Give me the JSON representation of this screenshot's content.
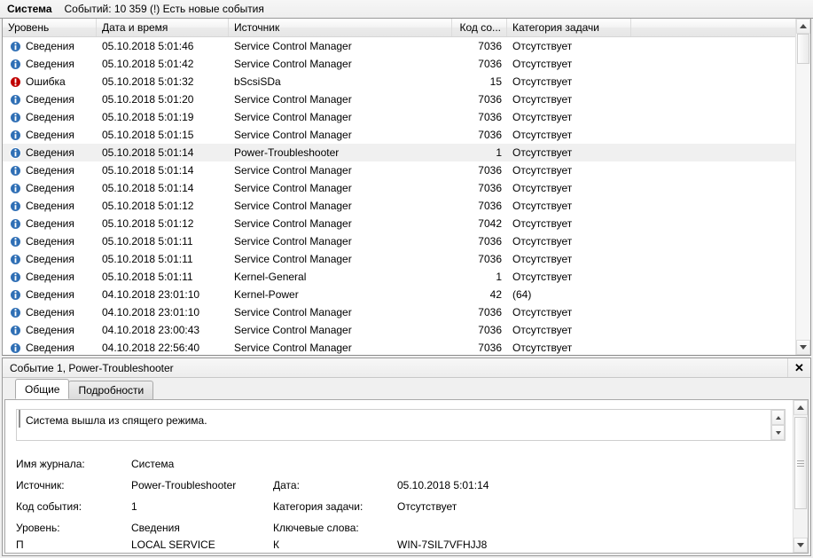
{
  "log_header": {
    "log_name": "Система",
    "status": "Событий: 10 359 (!) Есть новые события"
  },
  "columns": [
    {
      "key": "level",
      "label": "Уровень"
    },
    {
      "key": "date",
      "label": "Дата и время"
    },
    {
      "key": "source",
      "label": "Источник"
    },
    {
      "key": "code",
      "label": "Код со..."
    },
    {
      "key": "category",
      "label": "Категория задачи"
    },
    {
      "key": "blank",
      "label": ""
    }
  ],
  "rows": [
    {
      "icon": "info-icon",
      "level": "Сведения",
      "date": "05.10.2018 5:01:46",
      "source": "Service Control Manager",
      "code": "7036",
      "category": "Отсутствует",
      "selected": false
    },
    {
      "icon": "info-icon",
      "level": "Сведения",
      "date": "05.10.2018 5:01:42",
      "source": "Service Control Manager",
      "code": "7036",
      "category": "Отсутствует",
      "selected": false
    },
    {
      "icon": "error-icon",
      "level": "Ошибка",
      "date": "05.10.2018 5:01:32",
      "source": "bScsiSDa",
      "code": "15",
      "category": "Отсутствует",
      "selected": false
    },
    {
      "icon": "info-icon",
      "level": "Сведения",
      "date": "05.10.2018 5:01:20",
      "source": "Service Control Manager",
      "code": "7036",
      "category": "Отсутствует",
      "selected": false
    },
    {
      "icon": "info-icon",
      "level": "Сведения",
      "date": "05.10.2018 5:01:19",
      "source": "Service Control Manager",
      "code": "7036",
      "category": "Отсутствует",
      "selected": false
    },
    {
      "icon": "info-icon",
      "level": "Сведения",
      "date": "05.10.2018 5:01:15",
      "source": "Service Control Manager",
      "code": "7036",
      "category": "Отсутствует",
      "selected": false
    },
    {
      "icon": "info-icon",
      "level": "Сведения",
      "date": "05.10.2018 5:01:14",
      "source": "Power-Troubleshooter",
      "code": "1",
      "category": "Отсутствует",
      "selected": true
    },
    {
      "icon": "info-icon",
      "level": "Сведения",
      "date": "05.10.2018 5:01:14",
      "source": "Service Control Manager",
      "code": "7036",
      "category": "Отсутствует",
      "selected": false
    },
    {
      "icon": "info-icon",
      "level": "Сведения",
      "date": "05.10.2018 5:01:14",
      "source": "Service Control Manager",
      "code": "7036",
      "category": "Отсутствует",
      "selected": false
    },
    {
      "icon": "info-icon",
      "level": "Сведения",
      "date": "05.10.2018 5:01:12",
      "source": "Service Control Manager",
      "code": "7036",
      "category": "Отсутствует",
      "selected": false
    },
    {
      "icon": "info-icon",
      "level": "Сведения",
      "date": "05.10.2018 5:01:12",
      "source": "Service Control Manager",
      "code": "7042",
      "category": "Отсутствует",
      "selected": false
    },
    {
      "icon": "info-icon",
      "level": "Сведения",
      "date": "05.10.2018 5:01:11",
      "source": "Service Control Manager",
      "code": "7036",
      "category": "Отсутствует",
      "selected": false
    },
    {
      "icon": "info-icon",
      "level": "Сведения",
      "date": "05.10.2018 5:01:11",
      "source": "Service Control Manager",
      "code": "7036",
      "category": "Отсутствует",
      "selected": false
    },
    {
      "icon": "info-icon",
      "level": "Сведения",
      "date": "05.10.2018 5:01:11",
      "source": "Kernel-General",
      "code": "1",
      "category": "Отсутствует",
      "selected": false
    },
    {
      "icon": "info-icon",
      "level": "Сведения",
      "date": "04.10.2018 23:01:10",
      "source": "Kernel-Power",
      "code": "42",
      "category": "(64)",
      "selected": false
    },
    {
      "icon": "info-icon",
      "level": "Сведения",
      "date": "04.10.2018 23:01:10",
      "source": "Service Control Manager",
      "code": "7036",
      "category": "Отсутствует",
      "selected": false
    },
    {
      "icon": "info-icon",
      "level": "Сведения",
      "date": "04.10.2018 23:00:43",
      "source": "Service Control Manager",
      "code": "7036",
      "category": "Отсутствует",
      "selected": false
    },
    {
      "icon": "info-icon",
      "level": "Сведения",
      "date": "04.10.2018 22:56:40",
      "source": "Service Control Manager",
      "code": "7036",
      "category": "Отсутствует",
      "selected": false
    }
  ],
  "detail": {
    "title": "Событие 1, Power-Troubleshooter",
    "close_label": "✕",
    "tabs": [
      {
        "label": "Общие",
        "active": true
      },
      {
        "label": "Подробности",
        "active": false
      }
    ],
    "description": "Система вышла из спящего режима.",
    "fields": {
      "log_name_label": "Имя журнала:",
      "log_name_value": "Система",
      "source_label": "Источник:",
      "source_value": "Power-Troubleshooter",
      "date_label": "Дата:",
      "date_value": "05.10.2018 5:01:14",
      "event_id_label": "Код события:",
      "event_id_value": "1",
      "task_category_label": "Категория задачи:",
      "task_category_value": "Отсутствует",
      "level_label": "Уровень:",
      "level_value": "Сведения",
      "keywords_label": "Ключевые слова:",
      "keywords_value": "",
      "user_label": "П",
      "user_value": "LOCAL SERVICE",
      "computer_label": "К",
      "computer_value": "WIN-7SIL7VFHJJ8"
    }
  },
  "colors": {
    "info": "#2f6fb5",
    "error": "#c00000",
    "selection": "#f0f0f0",
    "header_bg": "#f0f0f0"
  }
}
